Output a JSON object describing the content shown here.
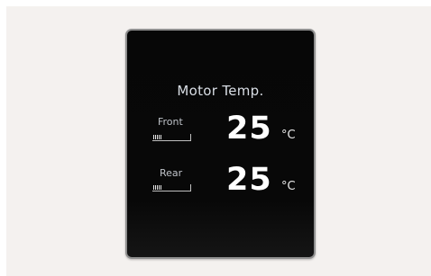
{
  "panel": {
    "title": "Motor Temp."
  },
  "front": {
    "label": "Front",
    "value": "25",
    "unit": "°C"
  },
  "rear": {
    "label": "Rear",
    "value": "25",
    "unit": "°C"
  },
  "colors": {
    "screen_background": "#070707",
    "screen_border": "#8f8f8f",
    "page_background": "#f4f1ef",
    "text_primary": "#ffffff",
    "text_secondary": "#bfc3c9"
  }
}
